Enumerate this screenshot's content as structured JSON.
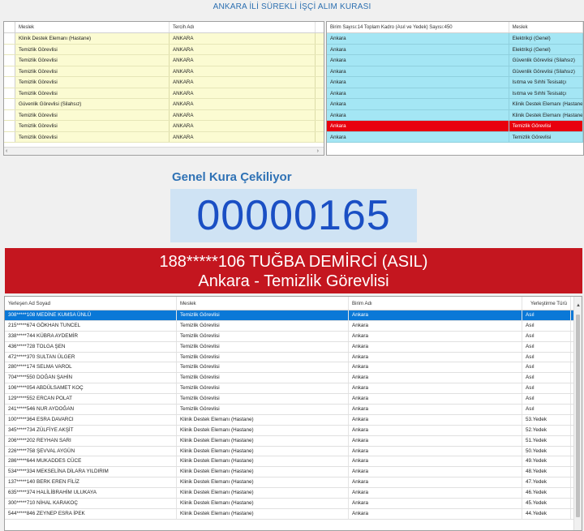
{
  "window": {
    "title": "ANKARA İLİ SÜREKLİ İŞÇİ ALIM KURASI"
  },
  "left_table": {
    "columns": [
      "Meslek",
      "Tercih Adı"
    ],
    "rows": [
      [
        "Klinik Destek Elemanı (Hastane)",
        "ANKARA"
      ],
      [
        "Temizlik Görevlisi",
        "ANKARA"
      ],
      [
        "Temizlik Görevlisi",
        "ANKARA"
      ],
      [
        "Temizlik Görevlisi",
        "ANKARA"
      ],
      [
        "Temizlik Görevlisi",
        "ANKARA"
      ],
      [
        "Temizlik Görevlisi",
        "ANKARA"
      ],
      [
        "Güvenlik Görevlisi (Silahsız)",
        "ANKARA"
      ],
      [
        "Temizlik Görevlisi",
        "ANKARA"
      ],
      [
        "Temizlik Görevlisi",
        "ANKARA"
      ],
      [
        "Temizlik Görevlisi",
        "ANKARA"
      ]
    ]
  },
  "right_table": {
    "columns": [
      "Birim Sayısı:14 Toplam Kadro (Asıl ve Yedek) Sayısı:450",
      "Meslek"
    ],
    "rows": [
      [
        "Ankara",
        "Elektrikçi (Genel)"
      ],
      [
        "Ankara",
        "Elektrikçi (Genel)"
      ],
      [
        "Ankara",
        "Güvenlik Görevlisi (Silahsız)"
      ],
      [
        "Ankara",
        "Güvenlik Görevlisi (Silahsız)"
      ],
      [
        "Ankara",
        "Isıtma ve Sıhhi Tesisatçı"
      ],
      [
        "Ankara",
        "Isıtma ve Sıhhi Tesisatçı"
      ],
      [
        "Ankara",
        "Klinik Destek Elemanı (Hastane)"
      ],
      [
        "Ankara",
        "Klinik Destek Elemanı (Hastane)"
      ],
      [
        "Ankara",
        "Temizlik Görevlisi"
      ],
      [
        "Ankara",
        "Temizlik Görevlisi"
      ]
    ],
    "highlighted_row_index": 8
  },
  "draw": {
    "label": "Genel Kura Çekiliyor",
    "number": "00000165",
    "winner_line1": "188*****106 TUĞBA DEMİRCİ (ASIL)",
    "winner_line2": "Ankara - Temizlik Görevlisi"
  },
  "results_table": {
    "columns": [
      "Yerleşen Ad Soyad",
      "Meslek",
      "Birim Adı",
      "Yerleştirme Türü"
    ],
    "selected_row_index": 0,
    "rows": [
      [
        "308*****108 MEDİNE KUMSA ÜNLÜ",
        "Temizlik Görevlisi",
        "Ankara",
        "Asıl"
      ],
      [
        "215*****674 GÖKHAN TUNCEL",
        "Temizlik Görevlisi",
        "Ankara",
        "Asıl"
      ],
      [
        "338*****744 KÜBRA AYDEMİR",
        "Temizlik Görevlisi",
        "Ankara",
        "Asıl"
      ],
      [
        "436*****728 TOLGA ŞEN",
        "Temizlik Görevlisi",
        "Ankara",
        "Asıl"
      ],
      [
        "472*****370 SULTAN ÜLGER",
        "Temizlik Görevlisi",
        "Ankara",
        "Asıl"
      ],
      [
        "280*****174 SELMA VAROL",
        "Temizlik Görevlisi",
        "Ankara",
        "Asıl"
      ],
      [
        "704*****550 DOĞAN ŞAHİN",
        "Temizlik Görevlisi",
        "Ankara",
        "Asıl"
      ],
      [
        "106*****054 ABDÜLSAMET KOÇ",
        "Temizlik Görevlisi",
        "Ankara",
        "Asıl"
      ],
      [
        "129*****552 ERCAN POLAT",
        "Temizlik Görevlisi",
        "Ankara",
        "Asıl"
      ],
      [
        "241*****546 NUR AYDOĞAN",
        "Temizlik Görevlisi",
        "Ankara",
        "Asıl"
      ],
      [
        "100*****364 ESRA DAVARCI",
        "Klinik Destek Elemanı (Hastane)",
        "Ankara",
        "53.Yedek"
      ],
      [
        "345*****734 ZÜLFİYE AKŞİT",
        "Klinik Destek Elemanı (Hastane)",
        "Ankara",
        "52.Yedek"
      ],
      [
        "206*****202 REYHAN SARI",
        "Klinik Destek Elemanı (Hastane)",
        "Ankara",
        "51.Yedek"
      ],
      [
        "226*****758 ŞEVVAL AYGÜN",
        "Klinik Destek Elemanı (Hastane)",
        "Ankara",
        "50.Yedek"
      ],
      [
        "286*****644 MUKADDES CÜCE",
        "Klinik Destek Elemanı (Hastane)",
        "Ankara",
        "49.Yedek"
      ],
      [
        "534*****334 MEKSELİNA DİLARA YILDIRIM",
        "Klinik Destek Elemanı (Hastane)",
        "Ankara",
        "48.Yedek"
      ],
      [
        "137*****140 BERK EREN FİLİZ",
        "Klinik Destek Elemanı (Hastane)",
        "Ankara",
        "47.Yedek"
      ],
      [
        "635*****374 HALİLİBRAHİM ULUKAYA",
        "Klinik Destek Elemanı (Hastane)",
        "Ankara",
        "46.Yedek"
      ],
      [
        "300*****710 NİHAL KARAKOÇ",
        "Klinik Destek Elemanı (Hastane)",
        "Ankara",
        "45.Yedek"
      ],
      [
        "544*****846 ZEYNEP ESRA İPEK",
        "Klinik Destek Elemanı (Hastane)",
        "Ankara",
        "44.Yedek"
      ]
    ]
  },
  "colors": {
    "title": "#2c6fb0",
    "yellow_row": "#fbfbd2",
    "cyan_row": "#a4e6f4",
    "red_row": "#e8000e",
    "banner": "#c4161f",
    "counter_bg": "#cfe3f4",
    "counter_text": "#1a4fc4",
    "selected_row": "#0a78d7"
  }
}
